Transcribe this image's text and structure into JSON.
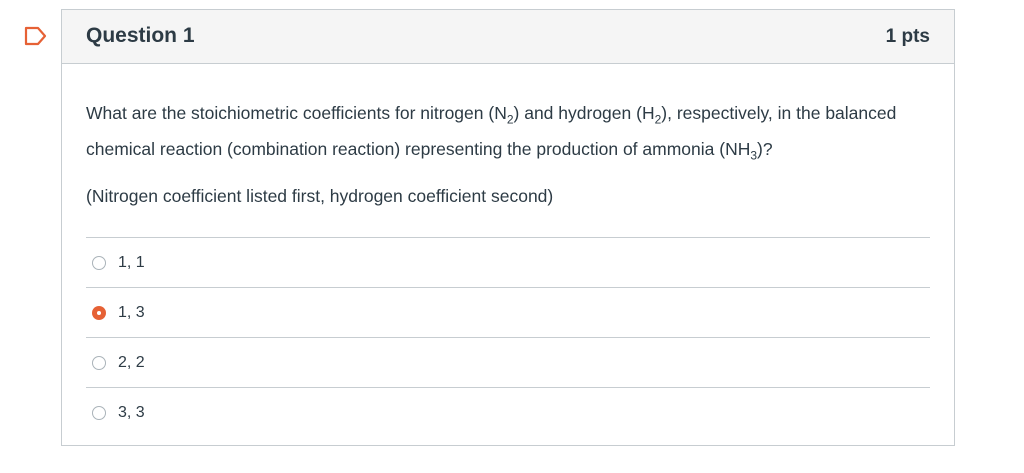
{
  "question": {
    "title": "Question 1",
    "points": "1 pts",
    "text_part1": "What are the stoichiometric coefficients for nitrogen (N",
    "sub1": "2",
    "text_part2": ") and hydrogen (H",
    "sub2": "2",
    "text_part3": "), respectively, in the balanced chemical reaction (combination reaction) representing the production of ammonia (NH",
    "sub3": "3",
    "text_part4": ")?",
    "note": "(Nitrogen coefficient listed first, hydrogen coefficient second)"
  },
  "answers": [
    {
      "label": "1, 1",
      "selected": false
    },
    {
      "label": "1, 3",
      "selected": true
    },
    {
      "label": "2, 2",
      "selected": false
    },
    {
      "label": "3, 3",
      "selected": false
    }
  ],
  "colors": {
    "accent": "#e66135",
    "border": "#c7cdd1",
    "header_bg": "#f5f5f5",
    "text": "#2d3b45"
  }
}
